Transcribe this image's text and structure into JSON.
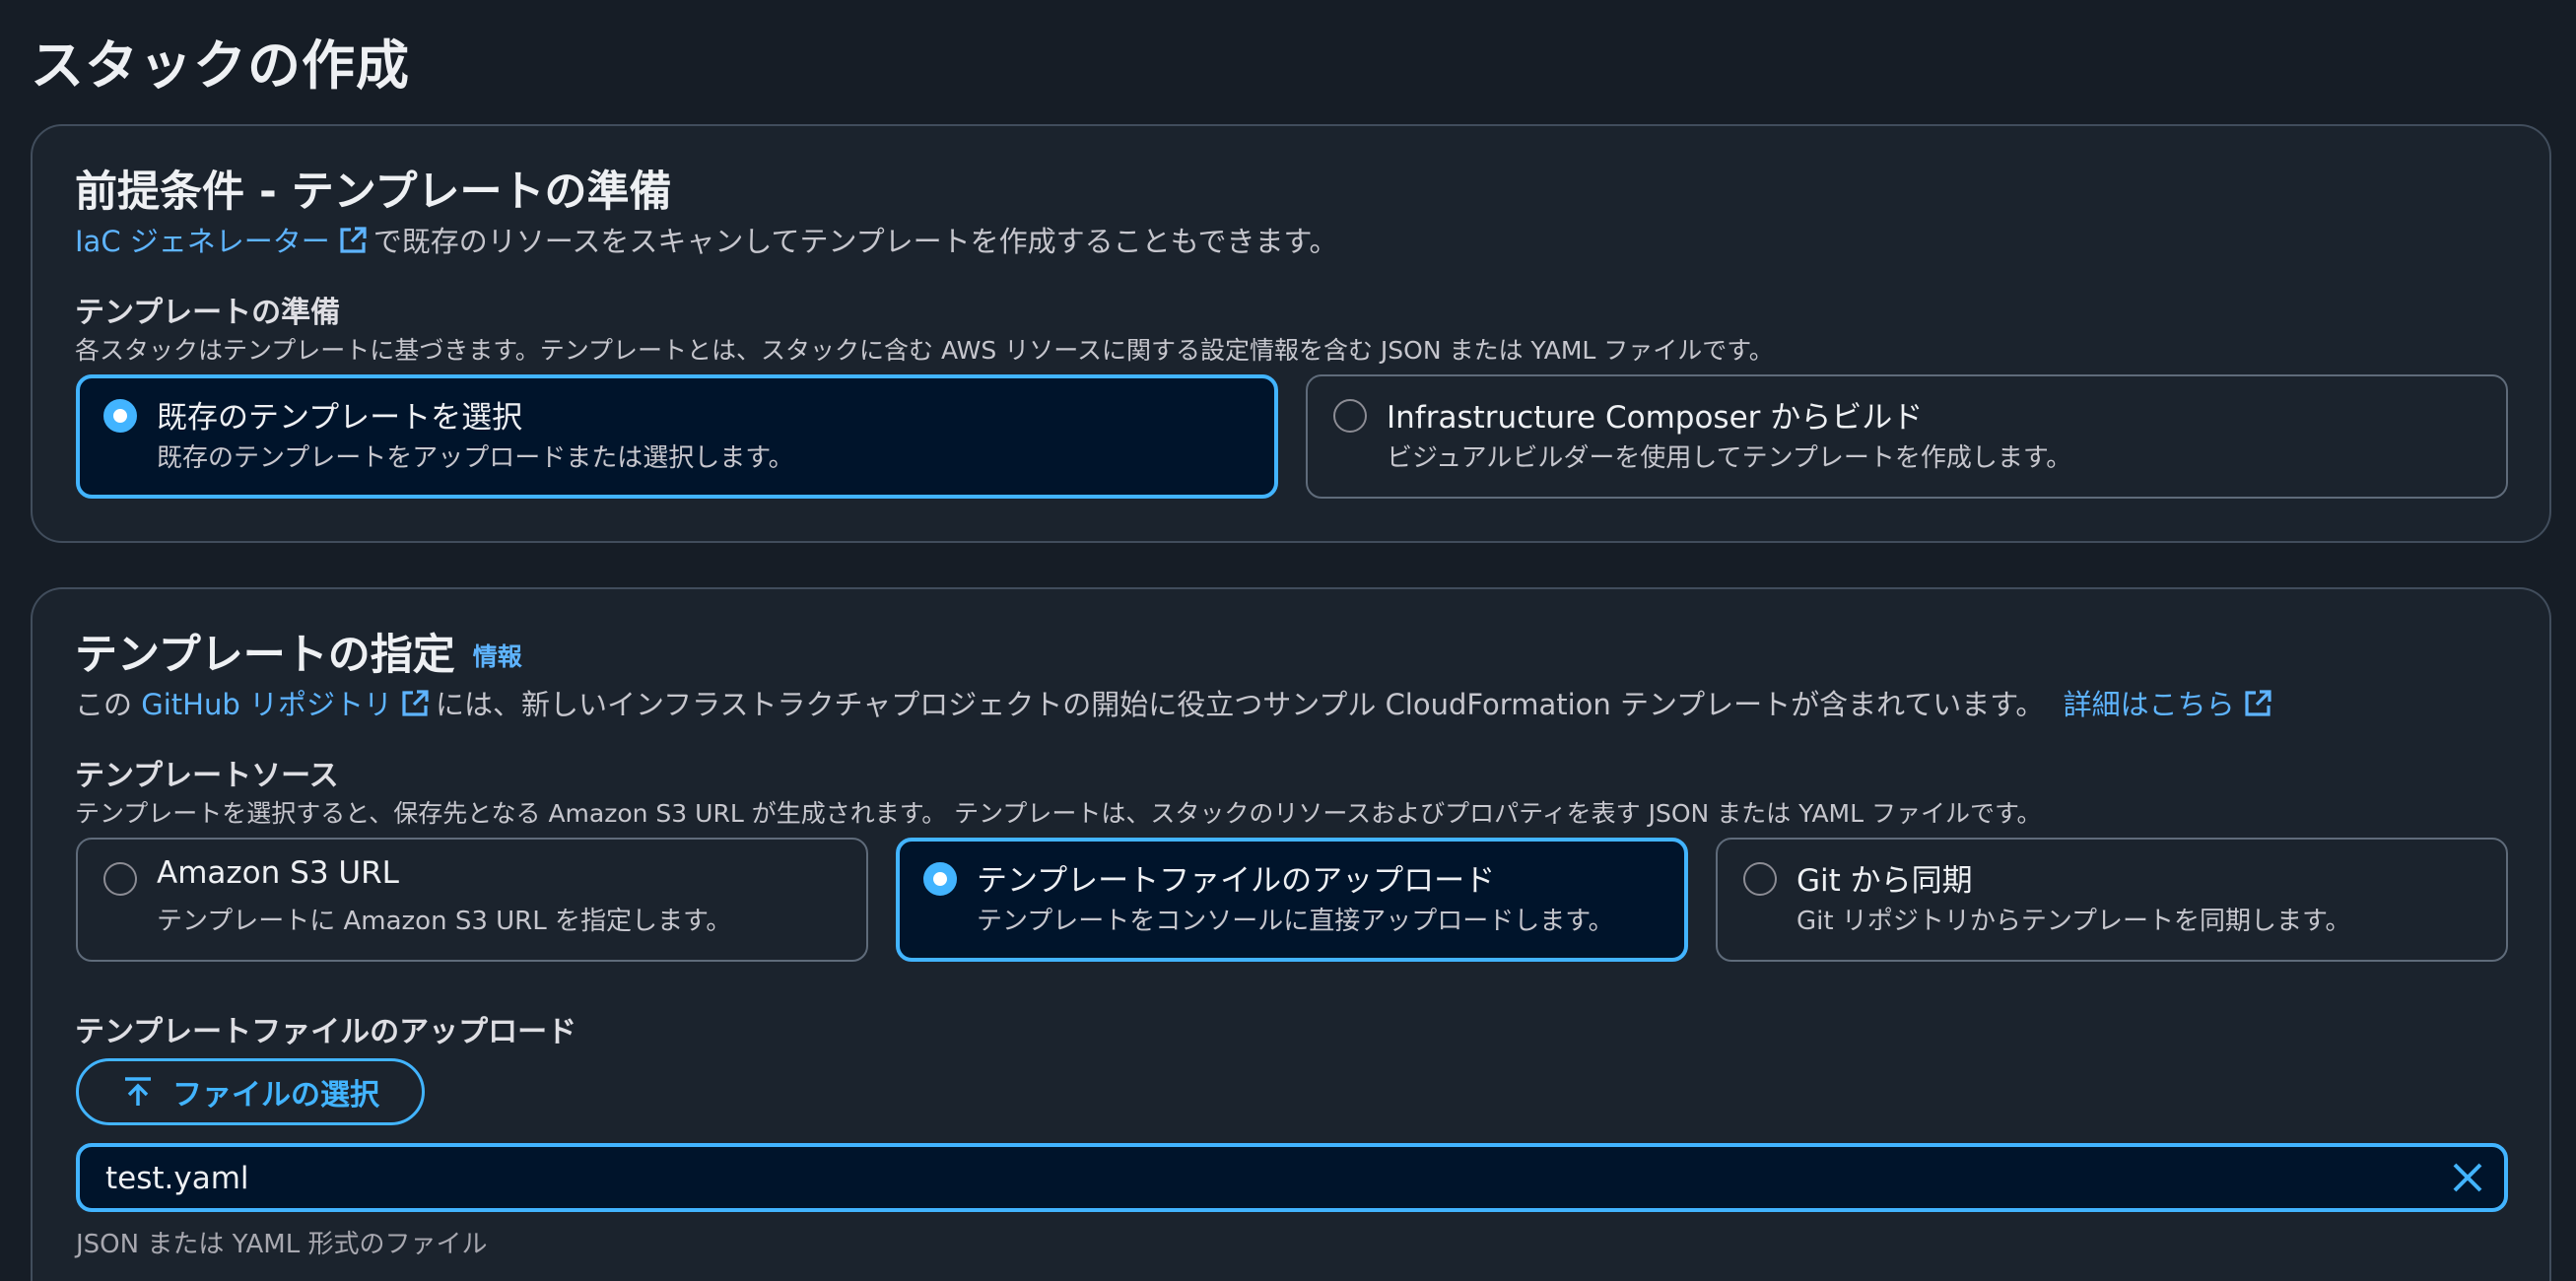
{
  "page": {
    "title": "スタックの作成"
  },
  "prereq": {
    "heading": "前提条件 - テンプレートの準備",
    "iac_link": "IaC ジェネレーター",
    "iac_text": "で既存のリソースをスキャンしてテンプレートを作成することもできます。",
    "label": "テンプレートの準備",
    "description": "各スタックはテンプレートに基づきます。テンプレートとは、スタックに含む AWS リソースに関する設定情報を含む JSON または YAML ファイルです。",
    "options": [
      {
        "title": "既存のテンプレートを選択",
        "desc": "既存のテンプレートをアップロードまたは選択します。",
        "selected": true
      },
      {
        "title": "Infrastructure Composer からビルド",
        "desc": "ビジュアルビルダーを使用してテンプレートを作成します。",
        "selected": false
      }
    ]
  },
  "spec": {
    "heading": "テンプレートの指定",
    "info": "情報",
    "text_before": "この",
    "github_link": "GitHub リポジトリ",
    "text_middle": "には、新しいインフラストラクチャプロジェクトの開始に役立つサンプル CloudFormation テンプレートが含まれています。",
    "learn_more": "詳細はこちら",
    "source_label": "テンプレートソース",
    "source_description": "テンプレートを選択すると、保存先となる Amazon S3 URL が生成されます。 テンプレートは、スタックのリソースおよびプロパティを表す JSON または YAML ファイルです。",
    "sources": [
      {
        "title": "Amazon S3 URL",
        "desc": "テンプレートに Amazon S3 URL を指定します。",
        "selected": false
      },
      {
        "title": "テンプレートファイルのアップロード",
        "desc": "テンプレートをコンソールに直接アップロードします。",
        "selected": true
      },
      {
        "title": "Git から同期",
        "desc": "Git リポジトリからテンプレートを同期します。",
        "selected": false
      }
    ],
    "upload_label": "テンプレートファイルのアップロード",
    "choose_file": "ファイルの選択",
    "file_name": "test.yaml",
    "hint": "JSON または YAML 形式のファイル"
  },
  "icons": {
    "external": "external-link-icon",
    "upload": "upload-icon",
    "clear": "close-icon"
  },
  "colors": {
    "accent": "#42b4ff",
    "link": "#5eb4ff",
    "background": "#161d26",
    "panel": "#1b232d",
    "selected_tile": "#00142b"
  }
}
